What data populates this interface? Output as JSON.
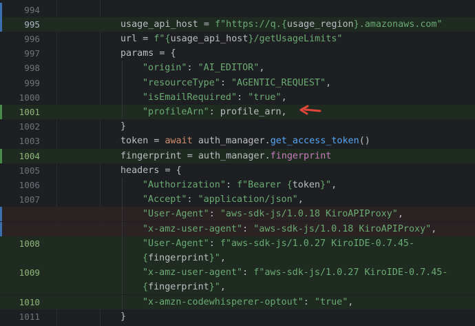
{
  "lines": [
    {
      "num": "994",
      "tokens": []
    },
    {
      "num": "995",
      "tokens": [
        [
          "def",
          "usage_api_host = "
        ],
        [
          "str",
          "f\"https://q.{"
        ],
        [
          "def",
          "usage_region"
        ],
        [
          "str",
          "}.amazonaws.com\""
        ]
      ]
    },
    {
      "num": "996",
      "tokens": [
        [
          "def",
          "url = "
        ],
        [
          "str",
          "f\"{"
        ],
        [
          "def",
          "usage_api_host"
        ],
        [
          "str",
          "}/getUsageLimits\""
        ]
      ]
    },
    {
      "num": "997",
      "tokens": [
        [
          "def",
          "params = {"
        ]
      ]
    },
    {
      "num": "998",
      "tokens": [
        [
          "str",
          "\"origin\""
        ],
        [
          "def",
          ": "
        ],
        [
          "str",
          "\"AI_EDITOR\""
        ],
        [
          "def",
          ","
        ]
      ]
    },
    {
      "num": "999",
      "tokens": [
        [
          "str",
          "\"resourceType\""
        ],
        [
          "def",
          ": "
        ],
        [
          "str",
          "\"AGENTIC_REQUEST\""
        ],
        [
          "def",
          ","
        ]
      ]
    },
    {
      "num": "1000",
      "tokens": [
        [
          "str",
          "\"isEmailRequired\""
        ],
        [
          "def",
          ": "
        ],
        [
          "str",
          "\"true\""
        ],
        [
          "def",
          ","
        ]
      ]
    },
    {
      "num": "1001",
      "tokens": [
        [
          "str",
          "\"profileArn\""
        ],
        [
          "def",
          ": profile_arn,"
        ]
      ]
    },
    {
      "num": "1002",
      "tokens": [
        [
          "def",
          "}"
        ]
      ]
    },
    {
      "num": "1003",
      "tokens": [
        [
          "def",
          "token = "
        ],
        [
          "key",
          "await "
        ],
        [
          "def",
          "auth_manager."
        ],
        [
          "fn",
          "get_access_token"
        ],
        [
          "def",
          "()"
        ]
      ]
    },
    {
      "num": "1004",
      "tokens": [
        [
          "def",
          "fingerprint = auth_manager."
        ],
        [
          "prop",
          "fingerprint"
        ]
      ]
    },
    {
      "num": "1005",
      "tokens": [
        [
          "def",
          "headers = {"
        ]
      ]
    },
    {
      "num": "1006",
      "tokens": [
        [
          "str",
          "\"Authorization\""
        ],
        [
          "def",
          ": "
        ],
        [
          "str",
          "f\"Bearer {"
        ],
        [
          "def",
          "token"
        ],
        [
          "str",
          "}\""
        ],
        [
          "def",
          ","
        ]
      ]
    },
    {
      "num": "1007",
      "tokens": [
        [
          "str",
          "\"Accept\""
        ],
        [
          "def",
          ": "
        ],
        [
          "str",
          "\"application/json\""
        ],
        [
          "def",
          ","
        ]
      ]
    },
    {
      "num": "",
      "tokens": [
        [
          "str",
          "\"User-Agent\""
        ],
        [
          "def",
          ": "
        ],
        [
          "str",
          "\"aws-sdk-js/1.0.18 KiroAPIProxy\""
        ],
        [
          "def",
          ","
        ]
      ]
    },
    {
      "num": "",
      "tokens": [
        [
          "str",
          "\"x-amz-user-agent\""
        ],
        [
          "def",
          ": "
        ],
        [
          "str",
          "\"aws-sdk-js/1.0.18 KiroAPIProxy\""
        ],
        [
          "def",
          ","
        ]
      ]
    },
    {
      "num": "1008",
      "tokens": [
        [
          "str",
          "\"User-Agent\""
        ],
        [
          "def",
          ": "
        ],
        [
          "str",
          "f\"aws-sdk-js/1.0.27 KiroIDE-0.7.45-"
        ]
      ]
    },
    {
      "num": "",
      "tokens": [
        [
          "str",
          "{"
        ],
        [
          "def",
          "fingerprint"
        ],
        [
          "str",
          "}\""
        ],
        [
          "def",
          ","
        ]
      ]
    },
    {
      "num": "1009",
      "tokens": [
        [
          "str",
          "\"x-amz-user-agent\""
        ],
        [
          "def",
          ": "
        ],
        [
          "str",
          "f\"aws-sdk-js/1.0.27 KiroIDE-0.7.45-"
        ]
      ]
    },
    {
      "num": "",
      "tokens": [
        [
          "str",
          "{"
        ],
        [
          "def",
          "fingerprint"
        ],
        [
          "str",
          "}\""
        ],
        [
          "def",
          ","
        ]
      ]
    },
    {
      "num": "1010",
      "tokens": [
        [
          "str",
          "\"x-amzn-codewhisperer-optout\""
        ],
        [
          "def",
          ": "
        ],
        [
          "str",
          "\"true\""
        ],
        [
          "def",
          ","
        ]
      ]
    },
    {
      "num": "1011",
      "tokens": [
        [
          "def",
          "}"
        ]
      ]
    }
  ],
  "colors": {
    "background": "#1e1f22",
    "string": "#6aab73",
    "keyword": "#cf8e6d",
    "function": "#56a8f5",
    "property": "#c77dbb",
    "arrow": "#e0453a"
  },
  "annotation": {
    "icon": "red-arrow-icon",
    "points_to_line": "1001"
  }
}
